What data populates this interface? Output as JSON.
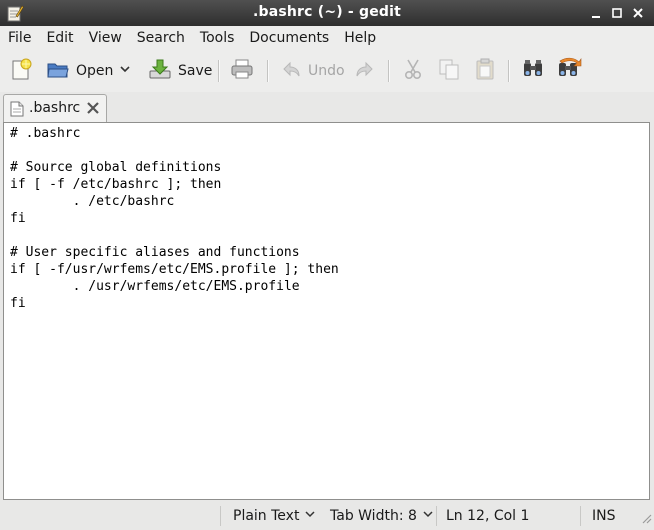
{
  "window": {
    "title": ".bashrc (~) - gedit",
    "app_icon": "gedit-notepad-icon",
    "controls": [
      "minimize-icon",
      "maximize-icon",
      "close-icon"
    ]
  },
  "menubar": {
    "items": [
      "File",
      "Edit",
      "View",
      "Search",
      "Tools",
      "Documents",
      "Help"
    ]
  },
  "toolbar": {
    "new_icon": "new-document-icon",
    "open_label": "Open",
    "save_label": "Save",
    "print_icon": "print-icon",
    "undo_label": "Undo",
    "redo_icon": "redo-icon",
    "cut_icon": "cut-icon",
    "copy_icon": "copy-icon",
    "paste_icon": "paste-icon",
    "find_icon": "find-binoculars-icon",
    "replace_icon": "find-replace-icon"
  },
  "tabs": [
    {
      "label": ".bashrc",
      "icon": "text-document-icon",
      "active": true
    }
  ],
  "editor": {
    "content": "# .bashrc\n\n# Source global definitions\nif [ -f /etc/bashrc ]; then\n\t. /etc/bashrc\nfi\n\n# User specific aliases and functions\nif [ -f/usr/wrfems/etc/EMS.profile ]; then\n\t. /usr/wrfems/etc/EMS.profile\nfi\n"
  },
  "statusbar": {
    "language": "Plain Text",
    "tab_width": "Tab Width: 8",
    "position": "Ln 12, Col 1",
    "mode": "INS"
  },
  "colors": {
    "titlebar": "#3c3c3c",
    "chrome": "#e8e8e7",
    "editor_bg": "#ffffff"
  }
}
